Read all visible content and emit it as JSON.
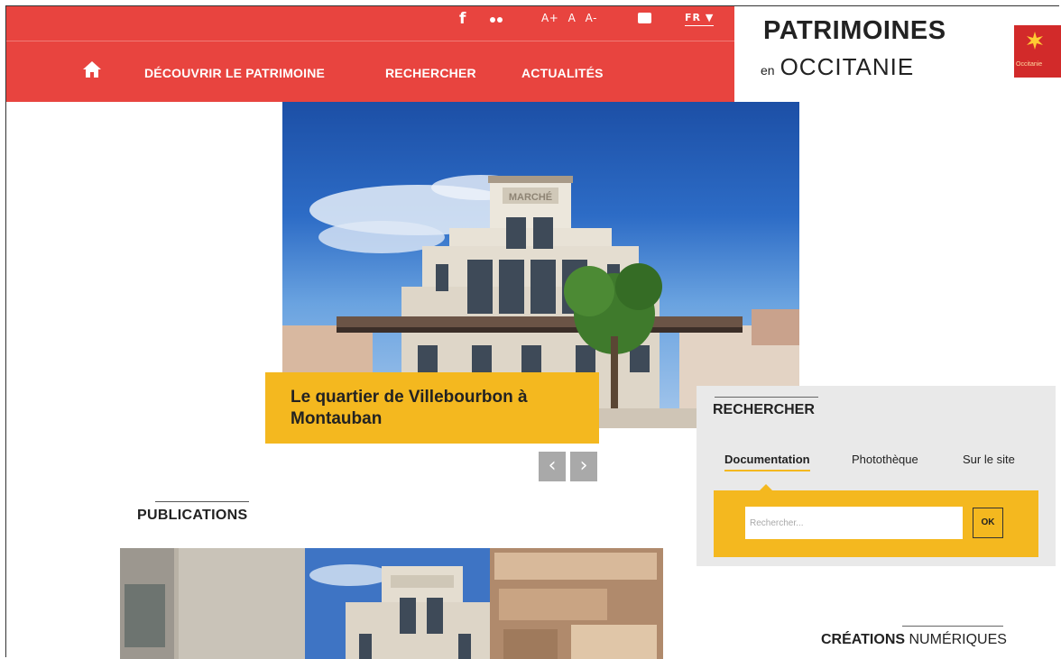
{
  "utility_bar": {
    "facebook_label": "f",
    "font_increase": "A+",
    "font_reset": "A",
    "font_decrease": "A-",
    "language": "FR ▼"
  },
  "nav": {
    "items": [
      {
        "label": "DÉCOUVRIR LE PATRIMOINE"
      },
      {
        "label": "RECHERCHER"
      },
      {
        "label": "ACTUALITÉS"
      }
    ]
  },
  "brand": {
    "title": "PATRIMOINES",
    "sub_en": "en",
    "sub_region": "OCCITANIE",
    "region_logo_text": "Occitanie"
  },
  "hero": {
    "building_sign": "MARCHÉ",
    "caption": "Le quartier de Villebourbon à Montauban",
    "prev": "‹",
    "next": "›"
  },
  "publications": {
    "title": "PUBLICATIONS"
  },
  "search": {
    "title": "RECHERCHER",
    "tabs": [
      {
        "label": "Documentation",
        "active": true
      },
      {
        "label": "Photothèque",
        "active": false
      },
      {
        "label": "Sur le site",
        "active": false
      }
    ],
    "placeholder": "Rechercher...",
    "ok": "OK"
  },
  "creations": {
    "title_bold": "CRÉATIONS",
    "title_rest": "NUMÉRIQUES"
  },
  "colors": {
    "header_red": "#e8443f",
    "accent_yellow": "#f4b81f",
    "panel_grey": "#e9e9e9"
  }
}
